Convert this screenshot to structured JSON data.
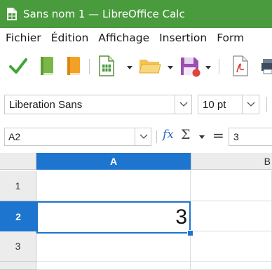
{
  "window": {
    "title": "Sans nom 1 — LibreOffice Calc"
  },
  "menubar": {
    "items": [
      {
        "label": "Fichier"
      },
      {
        "label": "Édition"
      },
      {
        "label": "Affichage"
      },
      {
        "label": "Insertion"
      },
      {
        "label": "Form"
      }
    ]
  },
  "toolbar": {
    "icons": [
      "checkmark-icon",
      "green-book-icon",
      "orange-book-icon",
      "new-spreadsheet-icon",
      "open-folder-icon",
      "save-icon",
      "export-pdf-icon",
      "print-icon"
    ]
  },
  "formatting": {
    "font_name": "Liberation Sans",
    "font_size": "10 pt"
  },
  "formula_bar": {
    "name_box": "A2",
    "fx_label": "fx",
    "sum_label": "Σ",
    "equals_label": "=",
    "content": "3"
  },
  "grid": {
    "columns": [
      "A",
      "B"
    ],
    "rows": [
      "1",
      "2",
      "3"
    ],
    "active_cell": {
      "column": "A",
      "row": "2",
      "value": "3"
    }
  },
  "colors": {
    "titlebar": "#4a9a3e",
    "accent": "#1e75d0"
  }
}
